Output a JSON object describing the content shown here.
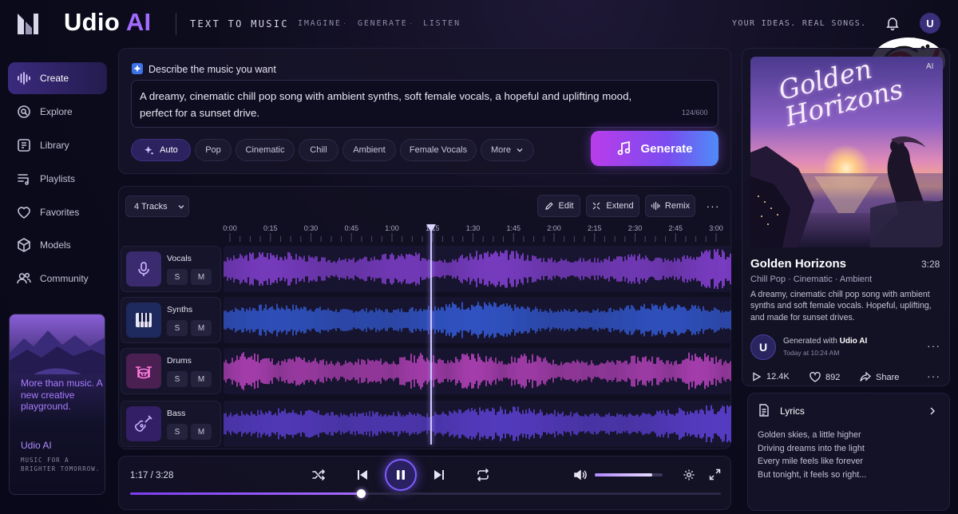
{
  "header": {
    "app_name": "Udio",
    "app_name_accent": "AI",
    "tagline": "TEXT TO MUSIC",
    "nav": [
      "IMAGINE",
      "GENERATE",
      "LISTEN"
    ],
    "tagline_right": "YOUR IDEAS. REAL SONGS.",
    "avatar_initial": "U"
  },
  "sidebar": {
    "items": [
      {
        "label": "Create",
        "icon": "waveform-icon",
        "active": true
      },
      {
        "label": "Explore",
        "icon": "search-icon",
        "active": false
      },
      {
        "label": "Library",
        "icon": "library-icon",
        "active": false
      },
      {
        "label": "Playlists",
        "icon": "playlist-icon",
        "active": false
      },
      {
        "label": "Favorites",
        "icon": "heart-icon",
        "active": false
      },
      {
        "label": "Models",
        "icon": "cube-icon",
        "active": false
      },
      {
        "label": "Community",
        "icon": "users-icon",
        "active": false
      }
    ],
    "promo": {
      "headline": "More than music. A new creative playground.",
      "brand": "Udio AI",
      "small": "MUSIC FOR A BRIGHTER TOMORROW."
    }
  },
  "prompt": {
    "label": "Describe the music you want",
    "text": "A dreamy, cinematic chill pop song with ambient synths, soft female vocals, a hopeful and uplifting mood, perfect for a sunset drive.",
    "char_count": "124/600",
    "chips": [
      "Auto",
      "Pop",
      "Cinematic",
      "Chill",
      "Ambient",
      "Female Vocals",
      "More"
    ],
    "generate_label": "Generate"
  },
  "tracks": {
    "dropdown_label": "4 Tracks",
    "tools": [
      "Edit",
      "Extend",
      "Remix"
    ],
    "ticks": [
      "0:00",
      "0:15",
      "0:30",
      "0:45",
      "1:00",
      "1:15",
      "1:30",
      "1:45",
      "2:00",
      "2:15",
      "2:30",
      "2:45",
      "3:00"
    ],
    "items": [
      {
        "name": "Vocals",
        "solo": "S",
        "mute": "M"
      },
      {
        "name": "Synths",
        "solo": "S",
        "mute": "M"
      },
      {
        "name": "Drums",
        "solo": "S",
        "mute": "M"
      },
      {
        "name": "Bass",
        "solo": "S",
        "mute": "M"
      }
    ],
    "colors": {
      "vocals": "#a24dff",
      "synths": "#3b6dff",
      "drums": "#e14fe0",
      "bass": "#6f4cff"
    }
  },
  "transport": {
    "time": "1:17 / 3:28",
    "progress": 0.39,
    "volume": 0.85
  },
  "song": {
    "cover_title": "Golden Horizons",
    "cover_badge": "AI",
    "title": "Golden Horizons",
    "duration": "3:28",
    "genres": "Chill Pop · Cinematic · Ambient",
    "description": "A dreamy, cinematic chill pop song with ambient synths and soft female vocals. Hopeful, uplifting, and made for sunset drives.",
    "author_initial": "U",
    "generated_prefix": "Generated with",
    "generated_brand": "Udio AI",
    "generated_time": "Today at 10:24 AM",
    "plays": "12.4K",
    "likes": "892",
    "share_label": "Share"
  },
  "lyrics": {
    "title": "Lyrics",
    "lines": [
      "Golden skies, a little higher",
      "Driving dreams into the light",
      "Every mile feels like forever",
      "But tonight, it feels so right..."
    ]
  }
}
